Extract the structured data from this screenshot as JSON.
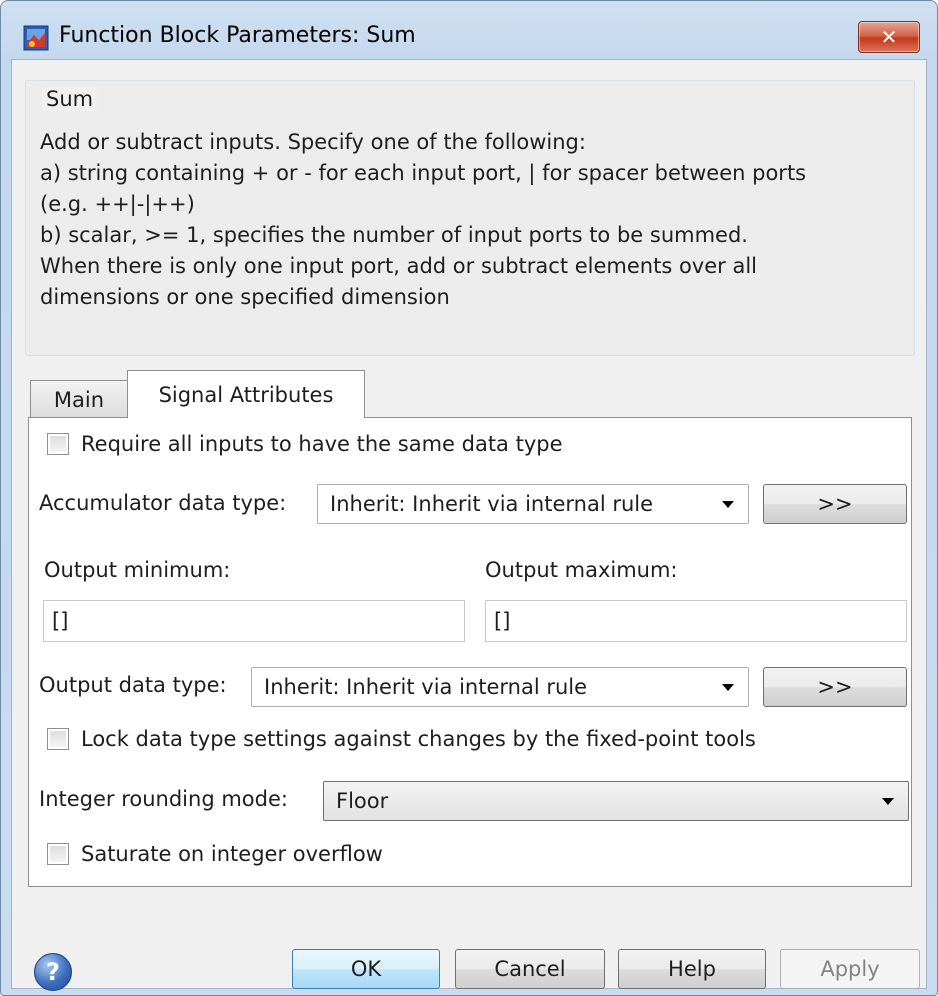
{
  "window": {
    "title": "Function Block Parameters: Sum",
    "close_label": "✕"
  },
  "group": {
    "legend": "Sum",
    "description_lines": [
      "Add or subtract inputs.  Specify one of the following:",
      "a) string containing + or - for each input port, | for spacer between ports",
      "(e.g. ++|-|++)",
      "b) scalar, >= 1, specifies the number of input ports to be summed.",
      "When there is only one input port, add or subtract elements over all",
      "dimensions or one specified dimension"
    ]
  },
  "tabs": [
    {
      "label": "Main",
      "selected": false
    },
    {
      "label": "Signal Attributes",
      "selected": true
    }
  ],
  "signal_attributes": {
    "require_same_type": {
      "label": "Require all inputs to have the same data type",
      "checked": false
    },
    "accumulator": {
      "label": "Accumulator data type:",
      "value": "Inherit: Inherit via internal rule",
      "button": ">>"
    },
    "output_minimum": {
      "label": "Output minimum:",
      "value": "[]"
    },
    "output_maximum": {
      "label": "Output maximum:",
      "value": "[]"
    },
    "output_type": {
      "label": "Output data type:",
      "value": "Inherit: Inherit via internal rule",
      "button": ">>"
    },
    "lock_settings": {
      "label": "Lock data type settings against changes by the fixed-point tools",
      "checked": false
    },
    "rounding": {
      "label": "Integer rounding mode:",
      "value": "Floor"
    },
    "saturate": {
      "label": "Saturate on integer overflow",
      "checked": false
    }
  },
  "footer": {
    "help_icon": "question-icon",
    "help_glyph": "?",
    "ok": "OK",
    "cancel": "Cancel",
    "help": "Help",
    "apply": "Apply"
  },
  "colors": {
    "title_gradient_top": "#cfe0f1",
    "dialog_background": "#f0f0f0",
    "ok_button_border": "#3c7fb1"
  }
}
